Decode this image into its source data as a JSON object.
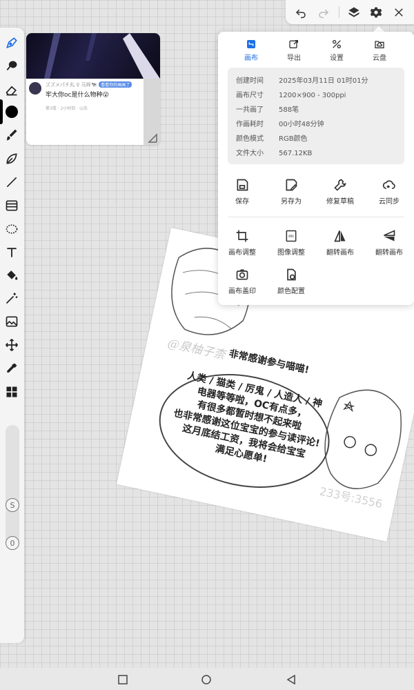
{
  "toolbar": {
    "tools": [
      "pen-icon",
      "brush-icon",
      "eraser-icon",
      "color-swatch",
      "smudge-icon",
      "leaf-brush-icon",
      "line-icon",
      "layer-panel-icon",
      "lasso-icon",
      "text-icon",
      "fill-bucket-icon",
      "magic-wand-icon",
      "image-import-icon",
      "transform-icon",
      "eyedropper-icon",
      "grid-icon"
    ],
    "current_color": "#000000",
    "size_knob_label": "S",
    "opacity_knob_label": "0"
  },
  "reference": {
    "user": "ズズメパチ丸 ♀ 马蹄🐄",
    "badge": "看看你的画画了",
    "post_text": "牢大你oc是什么物种😮",
    "meta": "第3楼 · 2小时前 · 山东"
  },
  "artwork": {
    "watermark": "@泉柚子柰",
    "headline": "非常感谢参与喵喵!",
    "bubble_lines": [
      "人类 / 猫类 / 厉鬼 / 人造人 / 神",
      "电器等等啦，OC有点多，",
      "有很多都暂时想不起来啦",
      "也非常感谢这位宝宝的参与读评论!",
      "这月底结工资，我将会给宝宝",
      "满足心愿单!"
    ],
    "corner_mark": "233号:3556"
  },
  "topbar": {
    "undo": "undo-icon",
    "redo": "redo-icon",
    "layers": "layers-icon",
    "settings": "gear-icon",
    "close": "close-icon"
  },
  "popup": {
    "tabs": [
      {
        "label": "画布",
        "icon": "canvas-icon",
        "active": true
      },
      {
        "label": "导出",
        "icon": "export-icon",
        "active": false
      },
      {
        "label": "设置",
        "icon": "tools-icon",
        "active": false
      },
      {
        "label": "云盘",
        "icon": "cloud-folder-icon",
        "active": false
      }
    ],
    "info": [
      {
        "key": "创建时间",
        "value": "2025年03月11日 01时01分"
      },
      {
        "key": "画布尺寸",
        "value": "1200×900 - 300ppi"
      },
      {
        "key": "一共画了",
        "value": "588笔"
      },
      {
        "key": "作画耗时",
        "value": "00小时48分钟"
      },
      {
        "key": "颜色模式",
        "value": "RGB颜色"
      },
      {
        "key": "文件大小",
        "value": "567.12KB"
      }
    ],
    "actions_row1": [
      {
        "label": "保存",
        "icon": "save-icon"
      },
      {
        "label": "另存为",
        "icon": "save-as-icon"
      },
      {
        "label": "修复草稿",
        "icon": "wrench-icon"
      },
      {
        "label": "云同步",
        "icon": "cloud-sync-icon"
      }
    ],
    "actions_row2": [
      {
        "label": "画布调整",
        "icon": "crop-icon"
      },
      {
        "label": "图像调整",
        "icon": "ppi-icon"
      },
      {
        "label": "翻转画布",
        "icon": "flip-horizontal-icon"
      },
      {
        "label": "翻转画布",
        "icon": "flip-vertical-icon"
      }
    ],
    "actions_row3": [
      {
        "label": "画布盖印",
        "icon": "camera-icon"
      },
      {
        "label": "颜色配置",
        "icon": "color-profile-icon"
      }
    ]
  },
  "colors": {
    "accent": "#1e6fe6",
    "panel_bg": "#ffffff",
    "info_bg": "#eeeeee",
    "canvas_bg": "#e4e4e4"
  }
}
